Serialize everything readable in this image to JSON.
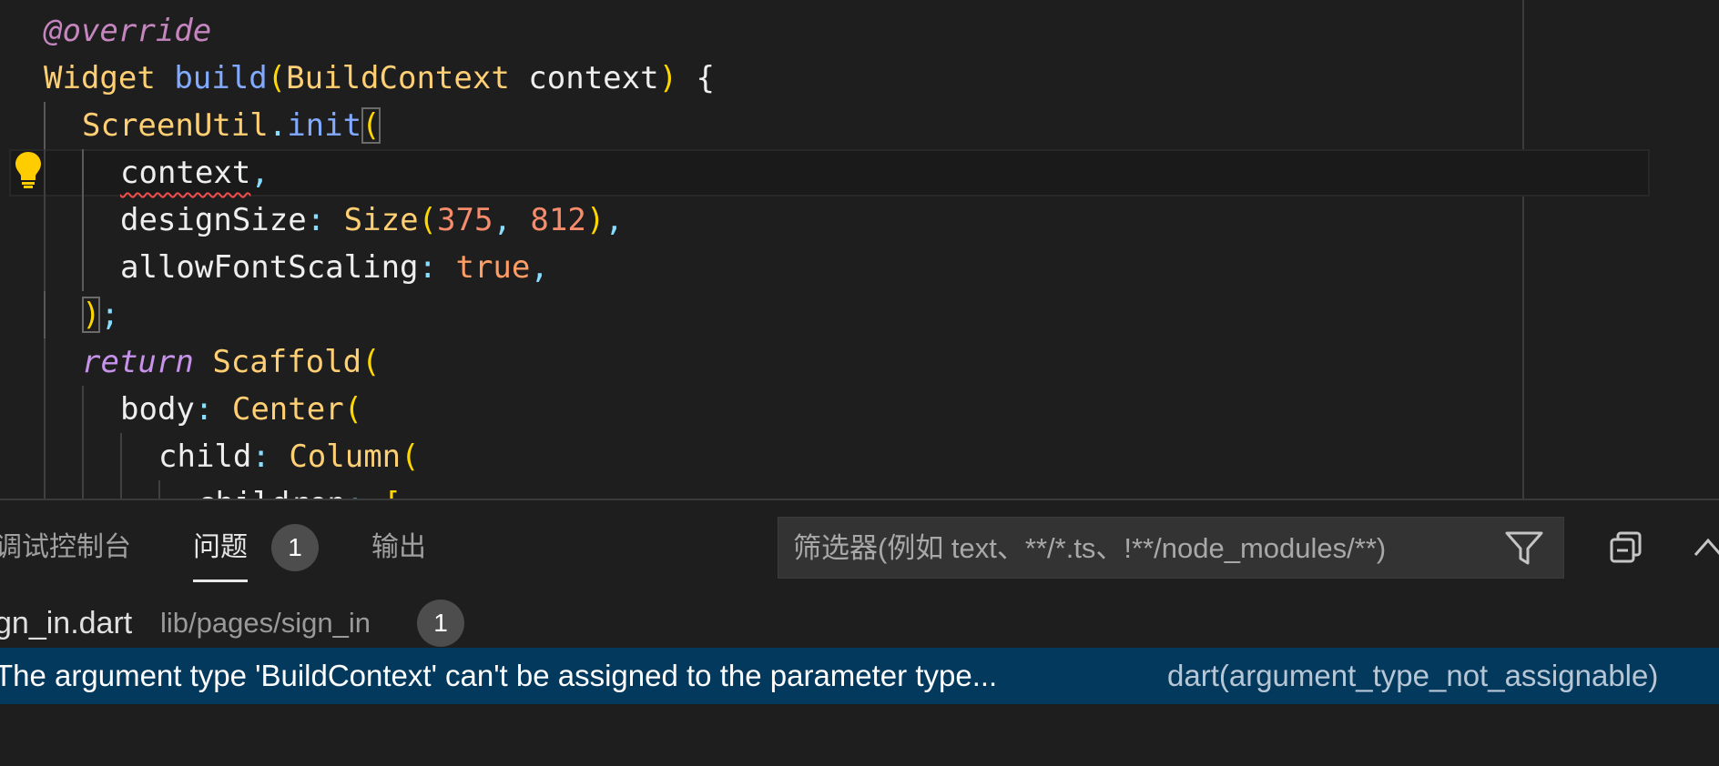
{
  "editor": {
    "lines": [
      {
        "tokens": [
          {
            "t": "@override",
            "c": "tok-anno"
          }
        ]
      },
      {
        "tokens": [
          {
            "t": "Widget",
            "c": "tok-type"
          },
          {
            "t": " "
          },
          {
            "t": "build",
            "c": "tok-fn"
          },
          {
            "t": "(",
            "c": "tok-brace"
          },
          {
            "t": "BuildContext",
            "c": "tok-type"
          },
          {
            "t": " "
          },
          {
            "t": "context",
            "c": "tok-var"
          },
          {
            "t": ")",
            "c": "tok-brace"
          },
          {
            "t": " "
          },
          {
            "t": "{",
            "c": "tok-var"
          }
        ]
      },
      {
        "tokens": [
          {
            "t": "ScreenUtil",
            "c": "tok-type"
          },
          {
            "t": ".",
            "c": "tok-punc"
          },
          {
            "t": "init",
            "c": "tok-fn"
          },
          {
            "t": "(",
            "c": "tok-brace bracket-box"
          }
        ]
      },
      {
        "tokens": [
          {
            "t": "context",
            "c": "tok-var squiggle"
          },
          {
            "t": ",",
            "c": "tok-punc"
          }
        ]
      },
      {
        "tokens": [
          {
            "t": "designSize",
            "c": "tok-param"
          },
          {
            "t": ": ",
            "c": "tok-punc"
          },
          {
            "t": "Size",
            "c": "tok-type"
          },
          {
            "t": "(",
            "c": "tok-brace"
          },
          {
            "t": "375",
            "c": "tok-num"
          },
          {
            "t": ", ",
            "c": "tok-punc"
          },
          {
            "t": "812",
            "c": "tok-num"
          },
          {
            "t": ")",
            "c": "tok-brace"
          },
          {
            "t": ",",
            "c": "tok-punc"
          }
        ]
      },
      {
        "tokens": [
          {
            "t": "allowFontScaling",
            "c": "tok-param"
          },
          {
            "t": ": ",
            "c": "tok-punc"
          },
          {
            "t": "true",
            "c": "tok-bool"
          },
          {
            "t": ",",
            "c": "tok-punc"
          }
        ]
      },
      {
        "tokens": [
          {
            "t": ")",
            "c": "tok-brace bracket-box"
          },
          {
            "t": ";",
            "c": "tok-punc"
          }
        ]
      },
      {
        "tokens": [
          {
            "t": "return",
            "c": "tok-kw"
          },
          {
            "t": " "
          },
          {
            "t": "Scaffold",
            "c": "tok-type"
          },
          {
            "t": "(",
            "c": "tok-brace"
          }
        ]
      },
      {
        "tokens": [
          {
            "t": "body",
            "c": "tok-param"
          },
          {
            "t": ": ",
            "c": "tok-punc"
          },
          {
            "t": "Center",
            "c": "tok-type"
          },
          {
            "t": "(",
            "c": "tok-brace"
          }
        ]
      },
      {
        "tokens": [
          {
            "t": "child",
            "c": "tok-param"
          },
          {
            "t": ": ",
            "c": "tok-punc"
          },
          {
            "t": "Column",
            "c": "tok-type"
          },
          {
            "t": "(",
            "c": "tok-brace"
          }
        ]
      },
      {
        "tokens": [
          {
            "t": "children",
            "c": "tok-param"
          },
          {
            "t": ": ",
            "c": "tok-punc"
          },
          {
            "t": "[",
            "c": "tok-brace"
          }
        ]
      }
    ]
  },
  "icons": {
    "lightbulb": "lightbulb-icon",
    "filter": "filter-icon",
    "collapse": "collapse-all-icon",
    "chevron": "chevron-up-icon"
  },
  "panel": {
    "tabs": [
      {
        "label": "调试控制台",
        "active": false
      },
      {
        "label": "问题",
        "active": true,
        "badge": "1"
      },
      {
        "label": "输出",
        "active": false
      }
    ],
    "filter": {
      "placeholder": "筛选器(例如 text、**/*.ts、!**/node_modules/**)",
      "value": ""
    },
    "file": {
      "name": "gn_in.dart",
      "path": "lib/pages/sign_in",
      "count": "1"
    },
    "problem": {
      "message": "The argument type 'BuildContext' can't be assigned to the parameter type...",
      "code": "dart(argument_type_not_assignable)"
    }
  },
  "colors": {
    "editor_bg": "#1e1e1e",
    "selection_row": "#04395e",
    "error_squiggle": "#f14c4c",
    "bulb": "#ffcc00"
  }
}
